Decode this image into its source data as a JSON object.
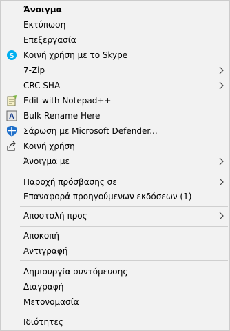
{
  "menu": {
    "items": [
      {
        "label": "Άνοιγμα"
      },
      {
        "label": "Εκτύπωση"
      },
      {
        "label": "Επεξεργασία"
      },
      {
        "label": "Κοινή χρήση με το Skype",
        "icon": "skype-icon"
      },
      {
        "label": "7-Zip",
        "submenu": true
      },
      {
        "label": "CRC SHA",
        "submenu": true
      },
      {
        "label": "Edit with Notepad++",
        "icon": "notepad-plus-plus-icon"
      },
      {
        "label": "Bulk Rename Here",
        "icon": "bulk-rename-icon"
      },
      {
        "label": "Σάρωση με Microsoft Defender...",
        "icon": "microsoft-defender-icon"
      },
      {
        "label": "Κοινή χρήση",
        "icon": "share-icon"
      },
      {
        "label": "Άνοιγμα με",
        "submenu": true
      },
      {
        "label": "Παροχή πρόσβασης σε",
        "submenu": true
      },
      {
        "label": "Επαναφορά προηγούμενων εκδόσεων (1)"
      },
      {
        "label": "Αποστολή προς",
        "submenu": true
      },
      {
        "label": "Αποκοπή"
      },
      {
        "label": "Αντιγραφή"
      },
      {
        "label": "Δημιουργία συντόμευσης"
      },
      {
        "label": "Διαγραφή"
      },
      {
        "label": "Μετονομασία"
      },
      {
        "label": "Ιδιότητες"
      }
    ]
  },
  "colors": {
    "background": "#f2f2f2",
    "border": "#cccccc",
    "separator": "#cfcfcf",
    "skype": "#00aff0",
    "defender": "#1e6fc9"
  }
}
